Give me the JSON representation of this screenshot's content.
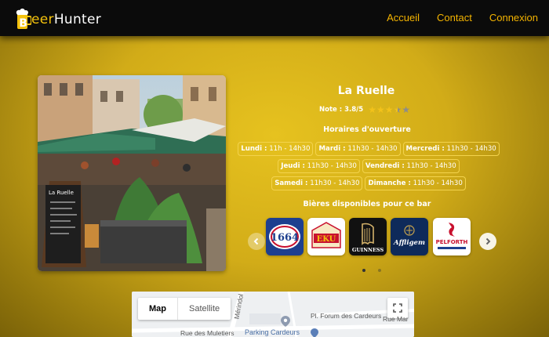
{
  "header": {
    "logo_first_letter": "B",
    "logo_rest": "eer",
    "logo_second": "Hunter",
    "nav": [
      "Accueil",
      "Contact",
      "Connexion"
    ]
  },
  "bar": {
    "name": "La Ruelle",
    "rating_label": "Note : 3.8/5",
    "rating": 3.8,
    "hours_title": "Horaires d'ouverture",
    "hours": [
      {
        "day": "Lundi :",
        "time": " 11h - 14h30"
      },
      {
        "day": "Mardi :",
        "time": " 11h30 - 14h30"
      },
      {
        "day": "Mercredi :",
        "time": " 11h30 - 14h30"
      },
      {
        "day": "Jeudi :",
        "time": " 11h30 - 14h30"
      },
      {
        "day": "Vendredi :",
        "time": " 11h30 - 14h30"
      },
      {
        "day": "Samedi :",
        "time": " 11h30 - 14h30"
      },
      {
        "day": "Dimanche :",
        "time": " 11h30 - 14h30"
      }
    ],
    "beers_title": "Bières disponibles pour ce bar",
    "beers": [
      {
        "name": "Kronenbourg 1664",
        "text": "1664",
        "icon": "kronenbourg-1664-logo"
      },
      {
        "name": "Eku",
        "text": "EKU",
        "icon": "eku-logo"
      },
      {
        "name": "Guinness",
        "text": "GUINNESS",
        "icon": "guinness-harp-logo"
      },
      {
        "name": "Affligem",
        "text": "Affligem",
        "icon": "affligem-logo"
      },
      {
        "name": "Pelforth",
        "text": "PELFORTH",
        "icon": "pelforth-logo"
      }
    ],
    "photo_sign": "La Ruelle"
  },
  "map": {
    "tabs": [
      "Map",
      "Satellite"
    ],
    "labels": [
      "Mérindol",
      "Pl. Forum des Cardeurs",
      "Rue Mar",
      "Rue des Muletiers",
      "Parking Cardeurs"
    ]
  },
  "colors": {
    "accent": "#f4b400",
    "background": "#d9b41c",
    "header": "#0b0b0b"
  }
}
